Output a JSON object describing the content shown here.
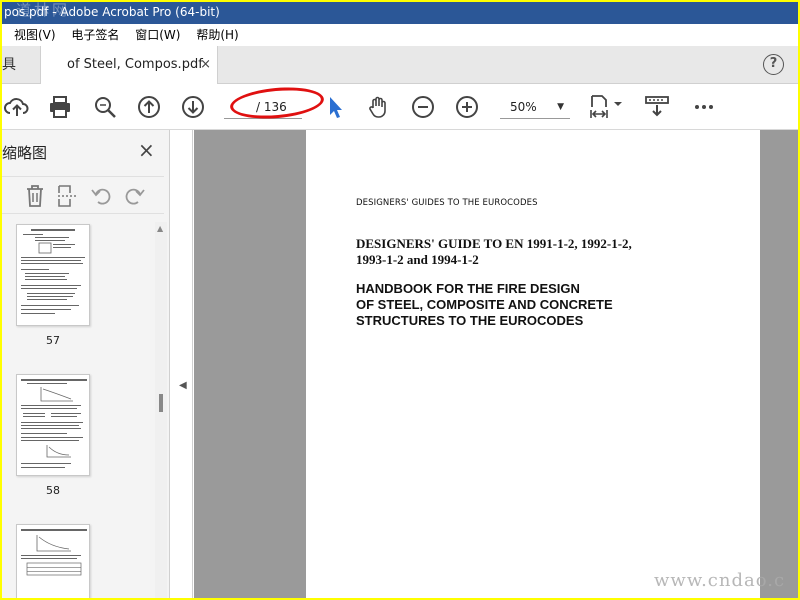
{
  "window": {
    "title": "pos.pdf - Adobe Acrobat Pro (64-bit)",
    "watermark_top": "道林网"
  },
  "menu": {
    "items": [
      "视图(V)",
      "电子签名",
      "窗口(W)",
      "帮助(H)"
    ]
  },
  "tabs": {
    "home_label": "具",
    "doc_label": "of Steel, Compos.pdf",
    "close_symbol": "×",
    "help_symbol": "?"
  },
  "toolbar": {
    "page_number": "",
    "page_total": "/ 136",
    "zoom": "50%",
    "zoom_caret": "▼",
    "icons": [
      "upload-icon",
      "print-icon",
      "search-zoom-icon",
      "page-up-icon",
      "page-down-icon",
      "select-arrow-icon",
      "hand-icon",
      "zoom-out-icon",
      "zoom-in-icon",
      "fit-page-icon",
      "scroll-mode-icon",
      "more-icon"
    ],
    "accent": "#2b6fd1",
    "highlight_color": "#e01010"
  },
  "panel": {
    "title": "缩略图",
    "close_symbol": "×",
    "thumbnails": [
      {
        "label": "57"
      },
      {
        "label": "58"
      },
      {
        "label": ""
      }
    ]
  },
  "document": {
    "series_line": "DESIGNERS' GUIDES TO THE EUROCODES",
    "guide_title_1": "DESIGNERS' GUIDE TO EN 1991-1-2, 1992-1-2,",
    "guide_title_2": "1993-1-2 and 1994-1-2",
    "handbook_1": "HANDBOOK FOR THE FIRE DESIGN",
    "handbook_2": "OF STEEL, COMPOSITE AND CONCRETE",
    "handbook_3": "STRUCTURES TO THE EUROCODES"
  },
  "footer": {
    "watermark": "www.cndao.c"
  }
}
